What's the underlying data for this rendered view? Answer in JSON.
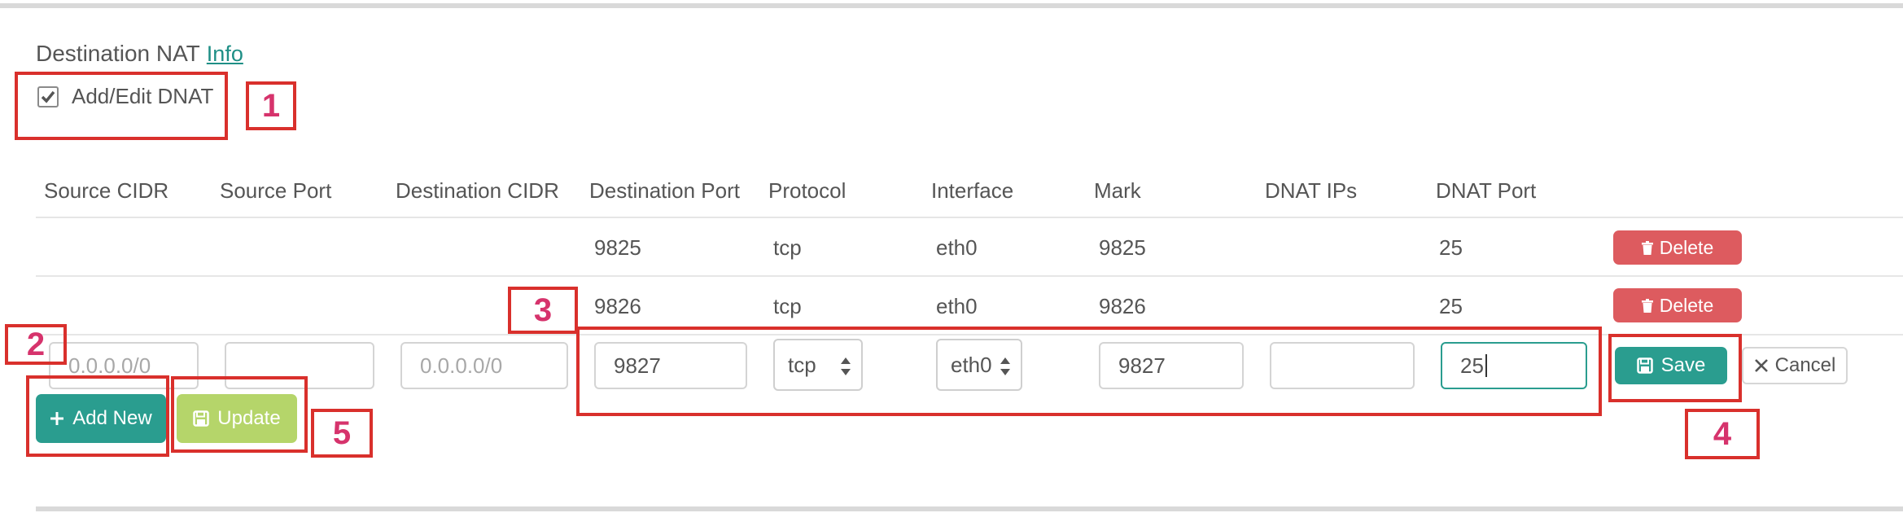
{
  "section": {
    "title": "Destination NAT",
    "info_link": "Info"
  },
  "checkbox": {
    "label": "Add/Edit DNAT",
    "checked": true
  },
  "table": {
    "headers": [
      "Source CIDR",
      "Source Port",
      "Destination CIDR",
      "Destination Port",
      "Protocol",
      "Interface",
      "Mark",
      "DNAT IPs",
      "DNAT Port"
    ],
    "rows": [
      {
        "dest_port": "9825",
        "protocol": "tcp",
        "interface": "eth0",
        "mark": "9825",
        "dnat_port": "25",
        "delete_label": "Delete"
      },
      {
        "dest_port": "9826",
        "protocol": "tcp",
        "interface": "eth0",
        "mark": "9826",
        "dnat_port": "25",
        "delete_label": "Delete"
      }
    ]
  },
  "edit_row": {
    "source_cidr_placeholder": "0.0.0.0/0",
    "source_port_value": "",
    "dest_cidr_placeholder": "0.0.0.0/0",
    "dest_port_value": "9827",
    "protocol_value": "tcp",
    "interface_value": "eth0",
    "mark_value": "9827",
    "dnat_ips_value": "",
    "dnat_port_value": "25",
    "save_label": "Save",
    "cancel_label": "Cancel"
  },
  "buttons": {
    "add_new_label": "Add New",
    "update_label": "Update"
  },
  "annotations": [
    "1",
    "2",
    "3",
    "4",
    "5"
  ],
  "colors": {
    "accent": "#2a9d8f",
    "danger": "#dd5b5f",
    "update": "#b5d56a",
    "annotation_box": "#d9302c",
    "annotation_number": "#d6336c",
    "link": "#1f8f86"
  }
}
